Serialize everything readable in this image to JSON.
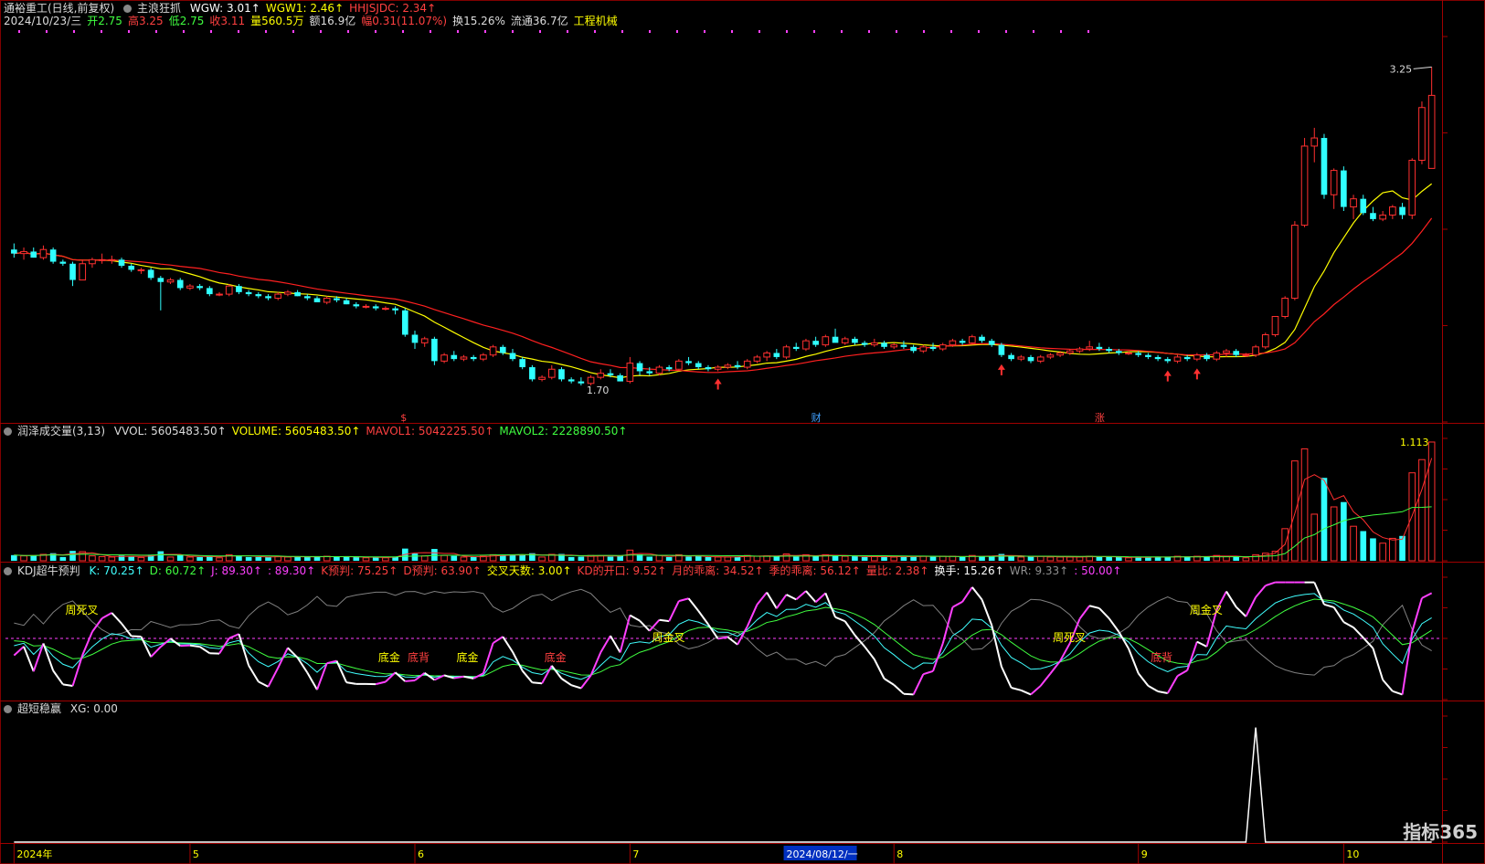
{
  "chart_data": [
    {
      "type": "candlestick",
      "panel": "main",
      "indicator_name": "主浪狂抓",
      "readouts": [
        {
          "label": "WGW: 3.01",
          "color": "#ffffff"
        },
        {
          "label": "WGW1: 2.46",
          "color": "#ffff00"
        },
        {
          "label": "HHJSJDC: 2.34",
          "color": "#ff4040"
        }
      ],
      "title": "通裕重工(日线,前复权)",
      "info_line": [
        {
          "label": "2024/10/23/三",
          "color": "#dcdcdc"
        },
        {
          "label": "开2.75",
          "color": "#40ff40"
        },
        {
          "label": "高3.25",
          "color": "#ff4040"
        },
        {
          "label": "低2.75",
          "color": "#40ff40"
        },
        {
          "label": "收3.11",
          "color": "#ff4040"
        },
        {
          "label": "量560.5万",
          "color": "#ffff00"
        },
        {
          "label": "额16.9亿",
          "color": "#dcdcdc"
        },
        {
          "label": "幅0.31(11.07%)",
          "color": "#ff4040"
        },
        {
          "label": "换15.26%",
          "color": "#dcdcdc"
        },
        {
          "label": "流通36.7亿",
          "color": "#dcdcdc"
        },
        {
          "label": "工程机械",
          "color": "#ffff00"
        }
      ],
      "ylim": [
        1.5,
        3.4
      ],
      "annotations": [
        {
          "label": "3.25",
          "kind": "high"
        },
        {
          "label": "1.70",
          "kind": "low"
        }
      ],
      "markers": [
        {
          "label": "$",
          "color": "#ff4040"
        },
        {
          "label": "财",
          "color": "#40a0ff"
        },
        {
          "label": "涨",
          "color": "#ff4040"
        }
      ],
      "series_note": "candles: o,h,l,c per day",
      "candles": [
        [
          2.35,
          2.38,
          2.31,
          2.33
        ],
        [
          2.33,
          2.36,
          2.3,
          2.34
        ],
        [
          2.34,
          2.36,
          2.31,
          2.31
        ],
        [
          2.31,
          2.37,
          2.3,
          2.35
        ],
        [
          2.35,
          2.36,
          2.28,
          2.29
        ],
        [
          2.29,
          2.3,
          2.27,
          2.28
        ],
        [
          2.28,
          2.29,
          2.17,
          2.2
        ],
        [
          2.2,
          2.3,
          2.2,
          2.28
        ],
        [
          2.28,
          2.31,
          2.26,
          2.3
        ],
        [
          2.3,
          2.33,
          2.28,
          2.3
        ],
        [
          2.3,
          2.32,
          2.28,
          2.3
        ],
        [
          2.3,
          2.31,
          2.26,
          2.27
        ],
        [
          2.27,
          2.28,
          2.24,
          2.25
        ],
        [
          2.25,
          2.26,
          2.23,
          2.25
        ],
        [
          2.25,
          2.26,
          2.2,
          2.21
        ],
        [
          2.21,
          2.22,
          2.05,
          2.19
        ],
        [
          2.19,
          2.21,
          2.18,
          2.2
        ],
        [
          2.2,
          2.21,
          2.15,
          2.16
        ],
        [
          2.16,
          2.18,
          2.15,
          2.17
        ],
        [
          2.17,
          2.18,
          2.15,
          2.16
        ],
        [
          2.16,
          2.17,
          2.12,
          2.13
        ],
        [
          2.13,
          2.14,
          2.12,
          2.13
        ],
        [
          2.13,
          2.18,
          2.12,
          2.17
        ],
        [
          2.17,
          2.18,
          2.13,
          2.14
        ],
        [
          2.14,
          2.15,
          2.12,
          2.13
        ],
        [
          2.13,
          2.14,
          2.11,
          2.12
        ],
        [
          2.12,
          2.13,
          2.1,
          2.11
        ],
        [
          2.11,
          2.14,
          2.1,
          2.13
        ],
        [
          2.13,
          2.15,
          2.12,
          2.14
        ],
        [
          2.14,
          2.15,
          2.12,
          2.12
        ],
        [
          2.12,
          2.13,
          2.1,
          2.11
        ],
        [
          2.11,
          2.12,
          2.09,
          2.09
        ],
        [
          2.09,
          2.12,
          2.08,
          2.11
        ],
        [
          2.11,
          2.12,
          2.09,
          2.1
        ],
        [
          2.1,
          2.11,
          2.08,
          2.08
        ],
        [
          2.08,
          2.09,
          2.06,
          2.07
        ],
        [
          2.07,
          2.08,
          2.06,
          2.07
        ],
        [
          2.07,
          2.08,
          2.05,
          2.06
        ],
        [
          2.06,
          2.07,
          2.05,
          2.06
        ],
        [
          2.06,
          2.07,
          2.03,
          2.05
        ],
        [
          2.05,
          2.06,
          1.92,
          1.93
        ],
        [
          1.93,
          1.95,
          1.86,
          1.89
        ],
        [
          1.89,
          1.92,
          1.87,
          1.91
        ],
        [
          1.91,
          1.92,
          1.78,
          1.8
        ],
        [
          1.8,
          1.84,
          1.79,
          1.83
        ],
        [
          1.83,
          1.85,
          1.8,
          1.81
        ],
        [
          1.81,
          1.83,
          1.8,
          1.82
        ],
        [
          1.82,
          1.83,
          1.8,
          1.81
        ],
        [
          1.81,
          1.84,
          1.8,
          1.83
        ],
        [
          1.83,
          1.88,
          1.82,
          1.87
        ],
        [
          1.87,
          1.88,
          1.83,
          1.84
        ],
        [
          1.84,
          1.86,
          1.8,
          1.81
        ],
        [
          1.81,
          1.82,
          1.76,
          1.77
        ],
        [
          1.77,
          1.78,
          1.7,
          1.71
        ],
        [
          1.71,
          1.73,
          1.7,
          1.72
        ],
        [
          1.72,
          1.78,
          1.71,
          1.76
        ],
        [
          1.76,
          1.77,
          1.7,
          1.71
        ],
        [
          1.71,
          1.72,
          1.69,
          1.7
        ],
        [
          1.7,
          1.72,
          1.68,
          1.69
        ],
        [
          1.69,
          1.73,
          1.68,
          1.72
        ],
        [
          1.72,
          1.76,
          1.71,
          1.74
        ],
        [
          1.74,
          1.76,
          1.72,
          1.73
        ],
        [
          1.73,
          1.74,
          1.7,
          1.7
        ],
        [
          1.7,
          1.82,
          1.69,
          1.79
        ],
        [
          1.79,
          1.8,
          1.73,
          1.75
        ],
        [
          1.75,
          1.77,
          1.73,
          1.74
        ],
        [
          1.74,
          1.78,
          1.73,
          1.77
        ],
        [
          1.77,
          1.78,
          1.75,
          1.76
        ],
        [
          1.76,
          1.81,
          1.75,
          1.8
        ],
        [
          1.8,
          1.82,
          1.78,
          1.79
        ],
        [
          1.79,
          1.8,
          1.76,
          1.77
        ],
        [
          1.77,
          1.78,
          1.75,
          1.76
        ],
        [
          1.76,
          1.78,
          1.75,
          1.77
        ],
        [
          1.77,
          1.79,
          1.76,
          1.78
        ],
        [
          1.78,
          1.8,
          1.76,
          1.77
        ],
        [
          1.77,
          1.81,
          1.76,
          1.8
        ],
        [
          1.8,
          1.83,
          1.79,
          1.82
        ],
        [
          1.82,
          1.85,
          1.8,
          1.84
        ],
        [
          1.84,
          1.86,
          1.81,
          1.82
        ],
        [
          1.82,
          1.88,
          1.81,
          1.87
        ],
        [
          1.87,
          1.89,
          1.85,
          1.86
        ],
        [
          1.86,
          1.91,
          1.85,
          1.9
        ],
        [
          1.9,
          1.92,
          1.87,
          1.88
        ],
        [
          1.88,
          1.93,
          1.87,
          1.92
        ],
        [
          1.92,
          1.96,
          1.9,
          1.89
        ],
        [
          1.89,
          1.92,
          1.88,
          1.91
        ],
        [
          1.91,
          1.92,
          1.88,
          1.89
        ],
        [
          1.89,
          1.9,
          1.87,
          1.88
        ],
        [
          1.88,
          1.91,
          1.87,
          1.89
        ],
        [
          1.89,
          1.9,
          1.86,
          1.87
        ],
        [
          1.87,
          1.89,
          1.86,
          1.88
        ],
        [
          1.88,
          1.9,
          1.86,
          1.87
        ],
        [
          1.87,
          1.88,
          1.84,
          1.85
        ],
        [
          1.85,
          1.88,
          1.84,
          1.87
        ],
        [
          1.87,
          1.89,
          1.85,
          1.86
        ],
        [
          1.86,
          1.89,
          1.85,
          1.88
        ],
        [
          1.88,
          1.91,
          1.87,
          1.9
        ],
        [
          1.9,
          1.91,
          1.88,
          1.89
        ],
        [
          1.89,
          1.93,
          1.88,
          1.92
        ],
        [
          1.92,
          1.93,
          1.89,
          1.9
        ],
        [
          1.9,
          1.91,
          1.87,
          1.88
        ],
        [
          1.88,
          1.89,
          1.82,
          1.83
        ],
        [
          1.83,
          1.84,
          1.8,
          1.81
        ],
        [
          1.81,
          1.83,
          1.8,
          1.82
        ],
        [
          1.82,
          1.83,
          1.79,
          1.8
        ],
        [
          1.8,
          1.83,
          1.79,
          1.82
        ],
        [
          1.82,
          1.84,
          1.81,
          1.83
        ],
        [
          1.83,
          1.85,
          1.82,
          1.84
        ],
        [
          1.84,
          1.86,
          1.83,
          1.85
        ],
        [
          1.85,
          1.87,
          1.84,
          1.86
        ],
        [
          1.86,
          1.9,
          1.85,
          1.87
        ],
        [
          1.87,
          1.89,
          1.85,
          1.86
        ],
        [
          1.86,
          1.87,
          1.84,
          1.85
        ],
        [
          1.85,
          1.86,
          1.83,
          1.84
        ],
        [
          1.84,
          1.85,
          1.83,
          1.84
        ],
        [
          1.84,
          1.85,
          1.82,
          1.83
        ],
        [
          1.83,
          1.84,
          1.81,
          1.82
        ],
        [
          1.82,
          1.83,
          1.8,
          1.81
        ],
        [
          1.81,
          1.82,
          1.79,
          1.8
        ],
        [
          1.8,
          1.83,
          1.79,
          1.82
        ],
        [
          1.82,
          1.83,
          1.8,
          1.81
        ],
        [
          1.81,
          1.84,
          1.8,
          1.83
        ],
        [
          1.83,
          1.84,
          1.8,
          1.81
        ],
        [
          1.81,
          1.85,
          1.8,
          1.84
        ],
        [
          1.84,
          1.86,
          1.82,
          1.85
        ],
        [
          1.85,
          1.86,
          1.82,
          1.83
        ],
        [
          1.83,
          1.84,
          1.82,
          1.83
        ],
        [
          1.83,
          1.88,
          1.82,
          1.87
        ],
        [
          1.87,
          1.94,
          1.86,
          1.93
        ],
        [
          1.93,
          2.02,
          1.92,
          2.02
        ],
        [
          2.02,
          2.12,
          2.01,
          2.11
        ],
        [
          2.11,
          2.49,
          2.1,
          2.47
        ],
        [
          2.47,
          2.9,
          2.46,
          2.86
        ],
        [
          2.86,
          2.95,
          2.78,
          2.9
        ],
        [
          2.9,
          2.92,
          2.6,
          2.62
        ],
        [
          2.62,
          2.75,
          2.55,
          2.74
        ],
        [
          2.74,
          2.76,
          2.54,
          2.56
        ],
        [
          2.56,
          2.62,
          2.5,
          2.6
        ],
        [
          2.6,
          2.62,
          2.52,
          2.53
        ],
        [
          2.53,
          2.56,
          2.49,
          2.5
        ],
        [
          2.5,
          2.54,
          2.49,
          2.52
        ],
        [
          2.52,
          2.57,
          2.5,
          2.56
        ],
        [
          2.56,
          2.58,
          2.5,
          2.52
        ],
        [
          2.52,
          2.8,
          2.5,
          2.79
        ],
        [
          2.79,
          3.08,
          2.77,
          3.05
        ],
        [
          2.75,
          3.25,
          2.75,
          3.11
        ]
      ],
      "ma_note": "yellow and red moving averages, computed from closes"
    },
    {
      "type": "bar",
      "panel": "volume",
      "indicator_name": "润泽成交量(3,13)",
      "readouts": [
        {
          "label": "VVOL: 5605483.50",
          "color": "#dcdcdc"
        },
        {
          "label": "VOLUME: 5605483.50",
          "color": "#ffff00"
        },
        {
          "label": "MAVOL1: 5042225.50",
          "color": "#ff4040"
        },
        {
          "label": "MAVOL2: 2228890.50",
          "color": "#40ff40"
        }
      ],
      "ylim": [
        0,
        1.113
      ],
      "axis_label": "1.113",
      "unit": "万手-scaled"
    },
    {
      "type": "line",
      "panel": "kdj",
      "indicator_name": "KDJ超牛预判",
      "readouts": [
        {
          "label": "K: 70.25",
          "color": "#40ffff"
        },
        {
          "label": "D: 60.72",
          "color": "#40ff40"
        },
        {
          "label": "J: 89.30",
          "color": "#ff40ff"
        },
        {
          "label": ": 89.30",
          "color": "#ff40ff"
        },
        {
          "label": "K预判: 75.25",
          "color": "#ff4040"
        },
        {
          "label": "D预判: 63.90",
          "color": "#ff4040"
        },
        {
          "label": "交叉天数: 3.00",
          "color": "#ffff00"
        },
        {
          "label": "KD的开口: 9.52",
          "color": "#ff4040"
        },
        {
          "label": "月的乖离: 34.52",
          "color": "#ff4040"
        },
        {
          "label": "季的乖离: 56.12",
          "color": "#ff4040"
        },
        {
          "label": "量比: 2.38",
          "color": "#ff4040"
        },
        {
          "label": "换手: 15.26",
          "color": "#ffffff"
        },
        {
          "label": "WR: 9.33",
          "color": "#909090"
        },
        {
          "label": ": 50.00",
          "color": "#ff40ff"
        }
      ],
      "ylim": [
        -10,
        110
      ],
      "refline": 50,
      "labels": [
        "周死叉",
        "底金",
        "底背",
        "底金",
        "底金",
        "周金叉",
        "周死叉",
        "底背",
        "周金叉"
      ]
    },
    {
      "type": "line",
      "panel": "xg",
      "indicator_name": "超短稳赢",
      "readouts": [
        {
          "label": "XG: 0.00",
          "color": "#dcdcdc"
        }
      ],
      "ylim": [
        0,
        1.1
      ],
      "spike_index": 127
    }
  ],
  "x_axis": {
    "labels": [
      "2024年",
      "5",
      "6",
      "7",
      "8",
      "9",
      "10"
    ],
    "label_index": [
      0,
      18,
      41,
      63,
      90,
      115,
      136
    ],
    "cursor_date": "2024/08/12/一"
  },
  "watermark": "指标365",
  "colors": {
    "up": "#ff3030",
    "down": "#30ffff",
    "ma_fast": "#ffff00",
    "ma_slow": "#ff2020",
    "bg": "#000000"
  }
}
